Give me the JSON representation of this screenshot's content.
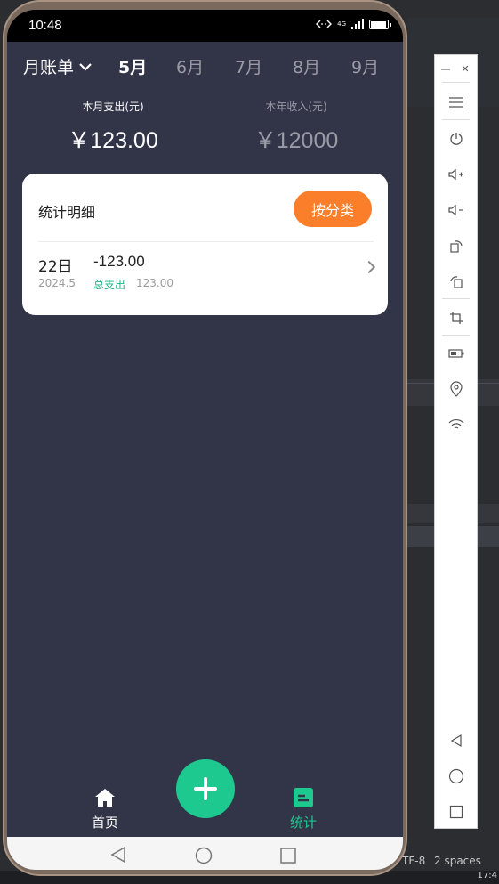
{
  "status_bar": {
    "time": "10:48",
    "network": "4G"
  },
  "tabs": {
    "month_book": "月账单",
    "months": [
      {
        "label": "5月",
        "active": true
      },
      {
        "label": "6月",
        "active": false
      },
      {
        "label": "7月",
        "active": false
      },
      {
        "label": "8月",
        "active": false
      },
      {
        "label": "9月",
        "active": false
      }
    ]
  },
  "summary": {
    "month_expense_label": "本月支出(元)",
    "month_expense_value": "￥123.00",
    "year_income_label": "本年收入(元)",
    "year_income_value": "￥12000"
  },
  "card": {
    "title": "统计明细",
    "category_button": "按分类",
    "records": [
      {
        "day": "22日",
        "year_month": "2024.5",
        "amount": "-123.00",
        "type": "总支出",
        "total": "123.00"
      }
    ]
  },
  "bottom_nav": {
    "home_label": "首页",
    "stats_label": "统计",
    "add_icon": "plus-icon"
  },
  "editor": {
    "encoding": "TF-8",
    "indent": "2 spaces",
    "clock": "17:4"
  },
  "colors": {
    "screen_bg": "#323448",
    "accent_orange": "#fb7f2a",
    "accent_green": "#1ec990",
    "record_type_green": "#1fb680"
  }
}
